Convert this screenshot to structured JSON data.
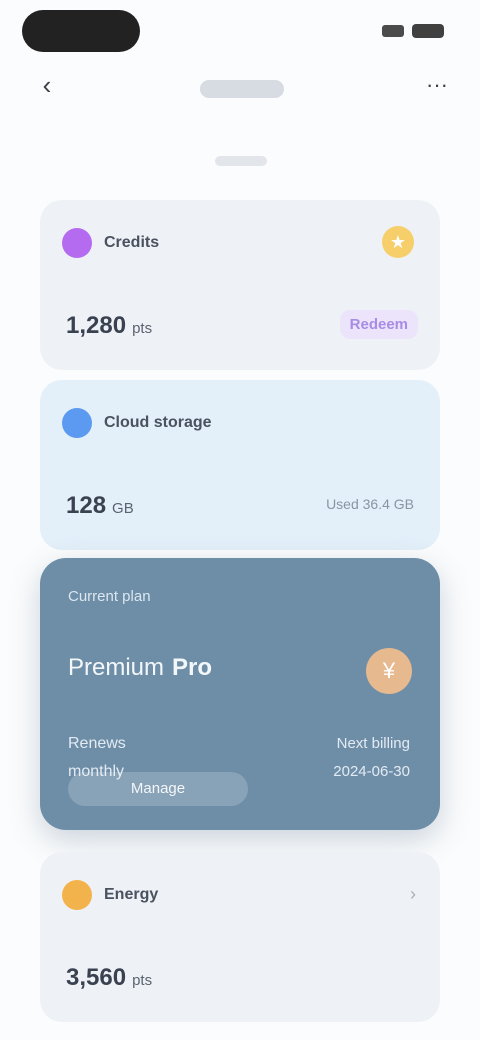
{
  "status_bar": {
    "time": ""
  },
  "nav": {
    "back_glyph": "‹",
    "more_glyph": "···"
  },
  "cards": {
    "credits": {
      "title": "Credits",
      "value": "1,280",
      "unit": "pts",
      "badge_glyph": "★",
      "action": "Redeem"
    },
    "storage": {
      "title": "Cloud storage",
      "value": "128",
      "unit": "GB",
      "meta": "Used 36.4 GB"
    },
    "plan": {
      "label": "Current plan",
      "prefix": "Premium",
      "name": "Pro",
      "coin": "¥",
      "left": [
        "Renews",
        "monthly"
      ],
      "right": [
        "Next billing",
        "2024-06-30"
      ],
      "button": "Manage"
    },
    "energy": {
      "title": "Energy",
      "value": "3,560",
      "unit": "pts"
    }
  },
  "colors": {
    "plan_bg": "#6e8ea8",
    "credits_icon": "#b46bf0",
    "storage_icon": "#5b9af0",
    "energy_icon": "#f2b34c"
  }
}
